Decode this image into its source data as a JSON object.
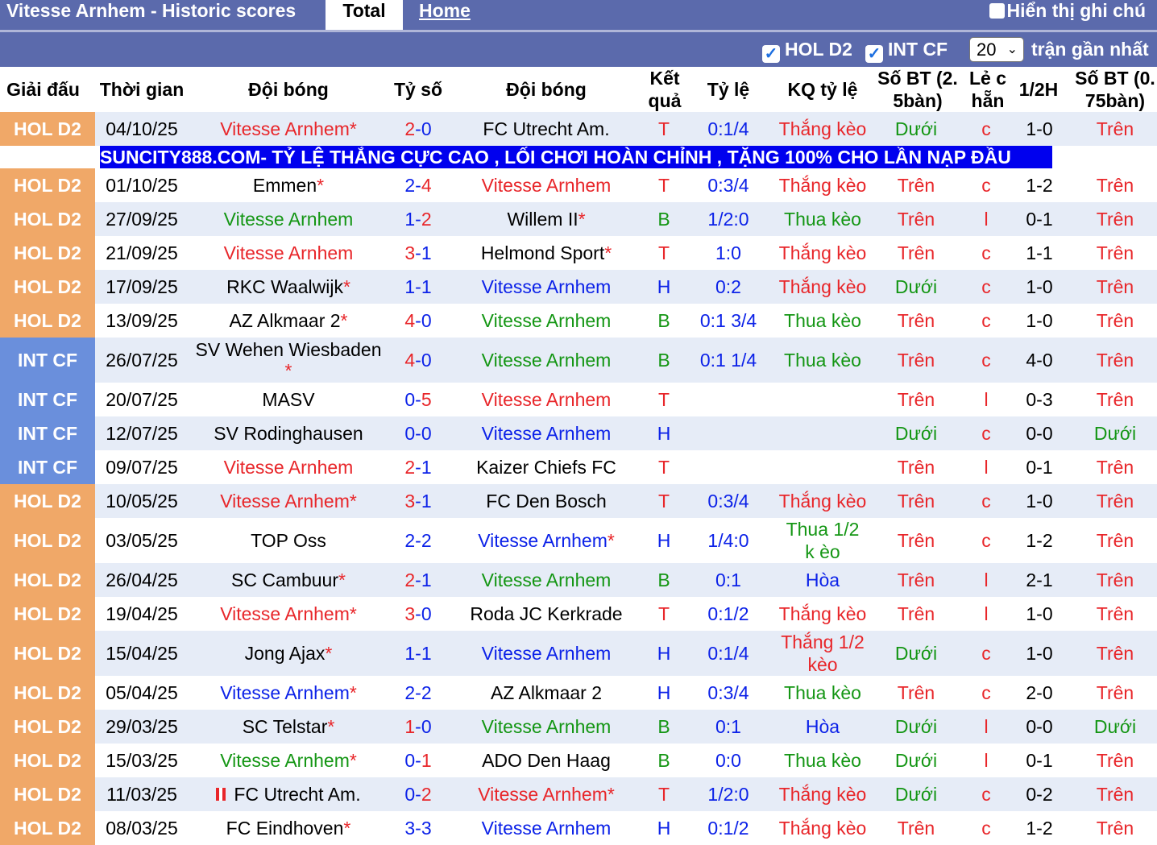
{
  "top": {
    "title": "Vitesse Arnhem - Historic scores",
    "tab_total": "Total",
    "tab_home": "Home",
    "show_notes": "Hiển thị ghi chú"
  },
  "filters": {
    "hol_d2": "HOL D2",
    "int_cf": "INT CF",
    "count_value": "20",
    "recent_label": "trận gần nhất",
    "check_mark": "✓"
  },
  "headers": {
    "league": "Giải đấu",
    "time": "Thời gian",
    "home": "Đội bóng",
    "score": "Tỷ số",
    "away": "Đội bóng",
    "result": "Kết quả",
    "odds": "Tỷ lệ",
    "odds_result": "KQ tỷ lệ",
    "goals1": "Số BT (2. 5bàn)",
    "oddeven": "Lẻ c hẵn",
    "half": "1/2H",
    "goals2": "Số BT (0. 75bàn)"
  },
  "banner": "SUNCITY888.COM- TỶ LỆ THẮNG CỰC CAO , LỐI CHƠI HOÀN CHỈNH , TẶNG 100% CHO LẦN NẠP ĐẦU",
  "colors": {
    "hol_d2_bg": "#f0a868",
    "int_cf_bg": "#6a8fdc",
    "header_bar": "#5b6aac",
    "row_light": "#e6ecf7",
    "row_white": "#ffffff",
    "red": "#e8262a",
    "green": "#149614",
    "blue": "#0c22e8",
    "black": "#000000"
  },
  "rows": [
    {
      "league": "HOL D2",
      "date": "04/10/25",
      "home": "Vitesse Arnhem",
      "home_star": "*",
      "home_color": "red",
      "score1": "2",
      "score2": "0",
      "away": "FC Utrecht Am.",
      "away_star": "",
      "away_color": "black",
      "result": "T",
      "odds": "0:1/4",
      "odds_result": "Thắng kèo",
      "odds_color": "red",
      "goals1": "Dưới",
      "goals1_color": "green",
      "oe": "c",
      "half": "1-0",
      "goals2": "Trên",
      "goals2_color": "red"
    },
    {
      "league": "HOL D2",
      "date": "01/10/25",
      "home": "Emmen",
      "home_star": "*",
      "home_color": "black",
      "score1": "2",
      "score2": "4",
      "away": "Vitesse Arnhem",
      "away_star": "",
      "away_color": "red",
      "result": "T",
      "odds": "0:3/4",
      "odds_result": "Thắng kèo",
      "odds_color": "red",
      "goals1": "Trên",
      "goals1_color": "red",
      "oe": "c",
      "half": "1-2",
      "goals2": "Trên",
      "goals2_color": "red"
    },
    {
      "league": "HOL D2",
      "date": "27/09/25",
      "home": "Vitesse Arnhem",
      "home_star": "",
      "home_color": "green",
      "score1": "1",
      "score2": "2",
      "away": "Willem II",
      "away_star": "*",
      "away_color": "black",
      "result": "B",
      "odds": "1/2:0",
      "odds_result": "Thua kèo",
      "odds_color": "green",
      "goals1": "Trên",
      "goals1_color": "red",
      "oe": "l",
      "half": "0-1",
      "goals2": "Trên",
      "goals2_color": "red"
    },
    {
      "league": "HOL D2",
      "date": "21/09/25",
      "home": "Vitesse Arnhem",
      "home_star": "",
      "home_color": "red",
      "score1": "3",
      "score2": "1",
      "away": "Helmond Sport",
      "away_star": "*",
      "away_color": "black",
      "result": "T",
      "odds": "1:0",
      "odds_result": "Thắng kèo",
      "odds_color": "red",
      "goals1": "Trên",
      "goals1_color": "red",
      "oe": "c",
      "half": "1-1",
      "goals2": "Trên",
      "goals2_color": "red"
    },
    {
      "league": "HOL D2",
      "date": "17/09/25",
      "home": "RKC Waalwijk",
      "home_star": "*",
      "home_color": "black",
      "score1": "1",
      "score2": "1",
      "away": "Vitesse Arnhem",
      "away_star": "",
      "away_color": "blue",
      "result": "H",
      "odds": "0:2",
      "odds_result": "Thắng kèo",
      "odds_color": "red",
      "goals1": "Dưới",
      "goals1_color": "green",
      "oe": "c",
      "half": "1-0",
      "goals2": "Trên",
      "goals2_color": "red"
    },
    {
      "league": "HOL D2",
      "date": "13/09/25",
      "home": "AZ Alkmaar 2",
      "home_star": "*",
      "home_color": "black",
      "score1": "4",
      "score2": "0",
      "away": "Vitesse Arnhem",
      "away_star": "",
      "away_color": "green",
      "result": "B",
      "odds": "0:1 3/4",
      "odds_result": "Thua kèo",
      "odds_color": "green",
      "goals1": "Trên",
      "goals1_color": "red",
      "oe": "c",
      "half": "1-0",
      "goals2": "Trên",
      "goals2_color": "red"
    },
    {
      "league": "INT CF",
      "date": "26/07/25",
      "home": "SV Wehen Wiesbaden",
      "home_star": "*",
      "home_color": "black",
      "score1": "4",
      "score2": "0",
      "away": "Vitesse Arnhem",
      "away_star": "",
      "away_color": "green",
      "result": "B",
      "odds": "0:1 1/4",
      "odds_result": "Thua kèo",
      "odds_color": "green",
      "goals1": "Trên",
      "goals1_color": "red",
      "oe": "c",
      "half": "4-0",
      "goals2": "Trên",
      "goals2_color": "red"
    },
    {
      "league": "INT CF",
      "date": "20/07/25",
      "home": "MASV",
      "home_star": "",
      "home_color": "black",
      "score1": "0",
      "score2": "5",
      "away": "Vitesse Arnhem",
      "away_star": "",
      "away_color": "red",
      "result": "T",
      "odds": "",
      "odds_result": "",
      "odds_color": "red",
      "goals1": "Trên",
      "goals1_color": "red",
      "oe": "l",
      "half": "0-3",
      "goals2": "Trên",
      "goals2_color": "red"
    },
    {
      "league": "INT CF",
      "date": "12/07/25",
      "home": "SV Rodinghausen",
      "home_star": "",
      "home_color": "black",
      "score1": "0",
      "score2": "0",
      "away": "Vitesse Arnhem",
      "away_star": "",
      "away_color": "blue",
      "result": "H",
      "odds": "",
      "odds_result": "",
      "odds_color": "red",
      "goals1": "Dưới",
      "goals1_color": "green",
      "oe": "c",
      "half": "0-0",
      "goals2": "Dưới",
      "goals2_color": "green"
    },
    {
      "league": "INT CF",
      "date": "09/07/25",
      "home": "Vitesse Arnhem",
      "home_star": "",
      "home_color": "red",
      "score1": "2",
      "score2": "1",
      "away": "Kaizer Chiefs FC",
      "away_star": "",
      "away_color": "black",
      "result": "T",
      "odds": "",
      "odds_result": "",
      "odds_color": "red",
      "goals1": "Trên",
      "goals1_color": "red",
      "oe": "l",
      "half": "0-1",
      "goals2": "Trên",
      "goals2_color": "red"
    },
    {
      "league": "HOL D2",
      "date": "10/05/25",
      "home": "Vitesse Arnhem",
      "home_star": "*",
      "home_color": "red",
      "score1": "3",
      "score2": "1",
      "away": "FC Den Bosch",
      "away_star": "",
      "away_color": "black",
      "result": "T",
      "odds": "0:3/4",
      "odds_result": "Thắng kèo",
      "odds_color": "red",
      "goals1": "Trên",
      "goals1_color": "red",
      "oe": "c",
      "half": "1-0",
      "goals2": "Trên",
      "goals2_color": "red"
    },
    {
      "league": "HOL D2",
      "date": "03/05/25",
      "home": "TOP Oss",
      "home_star": "",
      "home_color": "black",
      "score1": "2",
      "score2": "2",
      "away": "Vitesse Arnhem",
      "away_star": "*",
      "away_color": "blue",
      "result": "H",
      "odds": "1/4:0",
      "odds_result": "Thua 1/2 k èo",
      "odds_color": "green",
      "goals1": "Trên",
      "goals1_color": "red",
      "oe": "c",
      "half": "1-2",
      "goals2": "Trên",
      "goals2_color": "red"
    },
    {
      "league": "HOL D2",
      "date": "26/04/25",
      "home": "SC Cambuur",
      "home_star": "*",
      "home_color": "black",
      "score1": "2",
      "score2": "1",
      "away": "Vitesse Arnhem",
      "away_star": "",
      "away_color": "green",
      "result": "B",
      "odds": "0:1",
      "odds_result": "Hòa",
      "odds_color": "blue",
      "goals1": "Trên",
      "goals1_color": "red",
      "oe": "l",
      "half": "2-1",
      "goals2": "Trên",
      "goals2_color": "red"
    },
    {
      "league": "HOL D2",
      "date": "19/04/25",
      "home": "Vitesse Arnhem",
      "home_star": "*",
      "home_color": "red",
      "score1": "3",
      "score2": "0",
      "away": "Roda JC Kerkrade",
      "away_star": "",
      "away_color": "black",
      "result": "T",
      "odds": "0:1/2",
      "odds_result": "Thắng kèo",
      "odds_color": "red",
      "goals1": "Trên",
      "goals1_color": "red",
      "oe": "l",
      "half": "1-0",
      "goals2": "Trên",
      "goals2_color": "red"
    },
    {
      "league": "HOL D2",
      "date": "15/04/25",
      "home": "Jong Ajax",
      "home_star": "*",
      "home_color": "black",
      "score1": "1",
      "score2": "1",
      "away": "Vitesse Arnhem",
      "away_star": "",
      "away_color": "blue",
      "result": "H",
      "odds": "0:1/4",
      "odds_result": "Thắng 1/2 kèo",
      "odds_color": "red",
      "goals1": "Dưới",
      "goals1_color": "green",
      "oe": "c",
      "half": "1-0",
      "goals2": "Trên",
      "goals2_color": "red"
    },
    {
      "league": "HOL D2",
      "date": "05/04/25",
      "home": "Vitesse Arnhem",
      "home_star": "*",
      "home_color": "blue",
      "score1": "2",
      "score2": "2",
      "away": "AZ Alkmaar 2",
      "away_star": "",
      "away_color": "black",
      "result": "H",
      "odds": "0:3/4",
      "odds_result": "Thua kèo",
      "odds_color": "green",
      "goals1": "Trên",
      "goals1_color": "red",
      "oe": "c",
      "half": "2-0",
      "goals2": "Trên",
      "goals2_color": "red"
    },
    {
      "league": "HOL D2",
      "date": "29/03/25",
      "home": "SC Telstar",
      "home_star": "*",
      "home_color": "black",
      "score1": "1",
      "score2": "0",
      "away": "Vitesse Arnhem",
      "away_star": "",
      "away_color": "green",
      "result": "B",
      "odds": "0:1",
      "odds_result": "Hòa",
      "odds_color": "blue",
      "goals1": "Dưới",
      "goals1_color": "green",
      "oe": "l",
      "half": "0-0",
      "goals2": "Dưới",
      "goals2_color": "green"
    },
    {
      "league": "HOL D2",
      "date": "15/03/25",
      "home": "Vitesse Arnhem",
      "home_star": "*",
      "home_color": "green",
      "score1": "0",
      "score2": "1",
      "away": "ADO Den Haag",
      "away_star": "",
      "away_color": "black",
      "result": "B",
      "odds": "0:0",
      "odds_result": "Thua kèo",
      "odds_color": "green",
      "goals1": "Dưới",
      "goals1_color": "green",
      "oe": "l",
      "half": "0-1",
      "goals2": "Trên",
      "goals2_color": "red"
    },
    {
      "league": "HOL D2",
      "date": "11/03/25",
      "home": "FC Utrecht Am.",
      "home_star": "",
      "home_color": "black",
      "home_flag": true,
      "score1": "0",
      "score2": "2",
      "away": "Vitesse Arnhem",
      "away_star": "*",
      "away_color": "red",
      "result": "T",
      "odds": "1/2:0",
      "odds_result": "Thắng kèo",
      "odds_color": "red",
      "goals1": "Dưới",
      "goals1_color": "green",
      "oe": "c",
      "half": "0-2",
      "goals2": "Trên",
      "goals2_color": "red"
    },
    {
      "league": "HOL D2",
      "date": "08/03/25",
      "home": "FC Eindhoven",
      "home_star": "*",
      "home_color": "black",
      "score1": "3",
      "score2": "3",
      "away": "Vitesse Arnhem",
      "away_star": "",
      "away_color": "blue",
      "result": "H",
      "odds": "0:1/2",
      "odds_result": "Thắng kèo",
      "odds_color": "red",
      "goals1": "Trên",
      "goals1_color": "red",
      "oe": "c",
      "half": "1-2",
      "goals2": "Trên",
      "goals2_color": "red"
    }
  ]
}
